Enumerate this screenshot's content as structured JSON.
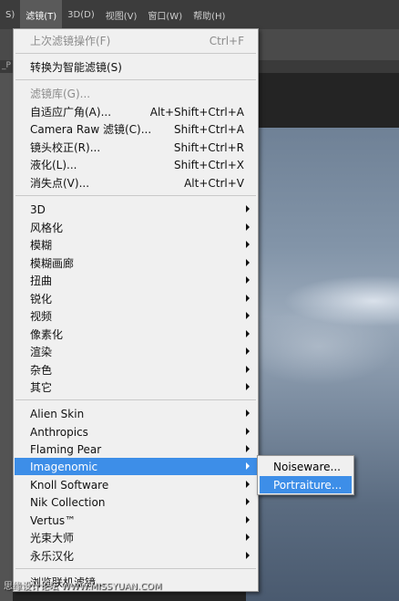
{
  "menubar": {
    "items": [
      {
        "label": "S)"
      },
      {
        "label": "滤镜(T)"
      },
      {
        "label": "3D(D)"
      },
      {
        "label": "视图(V)"
      },
      {
        "label": "窗口(W)"
      },
      {
        "label": "帮助(H)"
      }
    ]
  },
  "doc_tab": {
    "label": "_P"
  },
  "filter_menu": {
    "last_filter": {
      "label": "上次滤镜操作(F)",
      "shortcut": "Ctrl+F"
    },
    "convert_smart": {
      "label": "转换为智能滤镜(S)"
    },
    "gallery": {
      "label": "滤镜库(G)..."
    },
    "adaptive_wide": {
      "label": "自适应广角(A)...",
      "shortcut": "Alt+Shift+Ctrl+A"
    },
    "camera_raw": {
      "label": "Camera Raw 滤镜(C)...",
      "shortcut": "Shift+Ctrl+A"
    },
    "lens_correction": {
      "label": "镜头校正(R)...",
      "shortcut": "Shift+Ctrl+R"
    },
    "liquify": {
      "label": "液化(L)...",
      "shortcut": "Shift+Ctrl+X"
    },
    "vanishing_point": {
      "label": "消失点(V)...",
      "shortcut": "Alt+Ctrl+V"
    },
    "builtin": [
      "3D",
      "风格化",
      "模糊",
      "模糊画廊",
      "扭曲",
      "锐化",
      "视频",
      "像素化",
      "渲染",
      "杂色",
      "其它"
    ],
    "plugins": [
      "Alien Skin",
      "Anthropics",
      "Flaming Pear",
      "Imagenomic",
      "Knoll Software",
      "Nik Collection",
      "Vertus™",
      "光束大师",
      "永乐汉化"
    ],
    "browse_online": {
      "label": "浏览联机滤镜..."
    }
  },
  "imagenomic_submenu": {
    "items": [
      "Noiseware...",
      "Portraiture..."
    ]
  },
  "watermark": {
    "text": "思缘设计论坛 WWW.MISSYUAN.COM"
  }
}
